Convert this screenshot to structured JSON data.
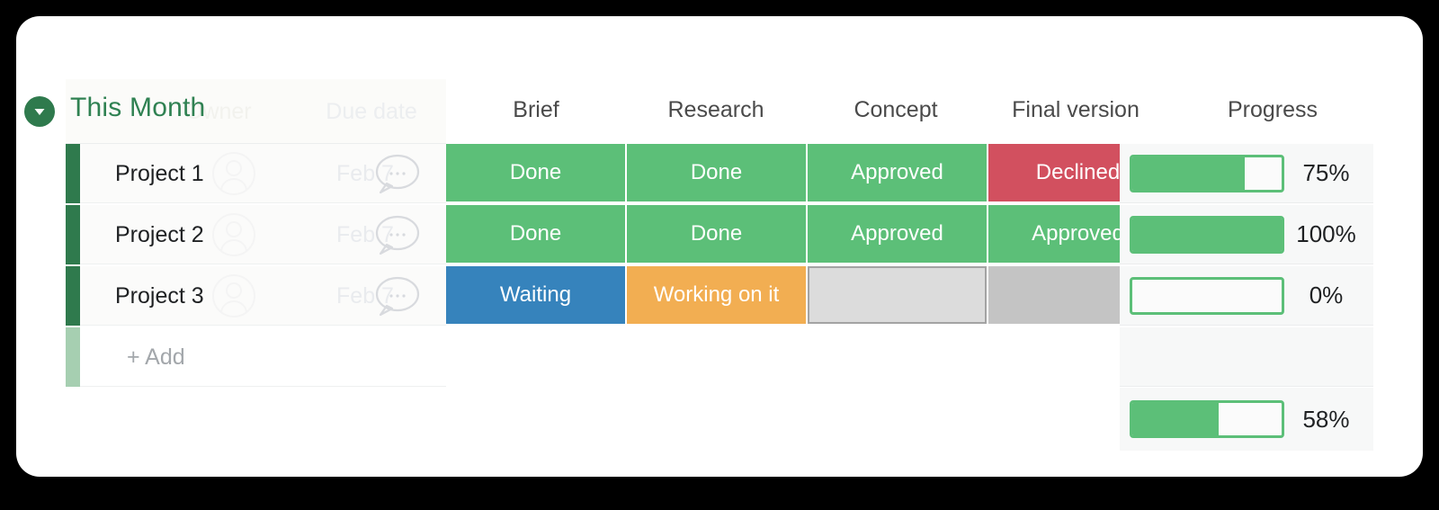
{
  "board": {
    "group": {
      "title": "This Month",
      "collapse_icon": "chevron-down-circle-icon",
      "accent_color": "#2f7a4d"
    },
    "ghost_headers": {
      "owner": "Owner",
      "due_date": "Due date"
    },
    "columns": [
      {
        "key": "brief",
        "label": "Brief"
      },
      {
        "key": "research",
        "label": "Research"
      },
      {
        "key": "concept",
        "label": "Concept"
      },
      {
        "key": "final_version",
        "label": "Final version"
      },
      {
        "key": "progress",
        "label": "Progress"
      }
    ],
    "rows": [
      {
        "name": "Project 1",
        "due_date": "Feb 7",
        "avatar_icon": "person-avatar-icon",
        "chat_icon": "chat-bubble-icon",
        "brief": "Done",
        "research": "Done",
        "concept": "Approved",
        "final_version": "Declined",
        "progress_label": "75%",
        "progress_value": 75
      },
      {
        "name": "Project 2",
        "due_date": "Feb 7",
        "avatar_icon": "person-avatar-icon",
        "chat_icon": "chat-bubble-icon",
        "brief": "Done",
        "research": "Done",
        "concept": "Approved",
        "final_version": "Approved",
        "progress_label": "100%",
        "progress_value": 100
      },
      {
        "name": "Project 3",
        "due_date": "Feb 7",
        "avatar_icon": "person-avatar-icon",
        "chat_icon": "chat-bubble-icon",
        "brief": "Waiting",
        "research": "Working on it",
        "concept": "",
        "final_version": "",
        "progress_label": "0%",
        "progress_value": 0
      }
    ],
    "add_row": {
      "label": "+ Add"
    },
    "summary": {
      "progress_label": "58%",
      "progress_value": 58
    },
    "status_colors": {
      "done": "#5cbf78",
      "approved": "#5cbf78",
      "declined": "#d2505f",
      "waiting": "#3683bc",
      "working_on_it": "#f2ae52",
      "empty_light": "#dcdcdc",
      "empty_solid": "#c4c4c4",
      "progress_green": "#5cbf78"
    }
  }
}
